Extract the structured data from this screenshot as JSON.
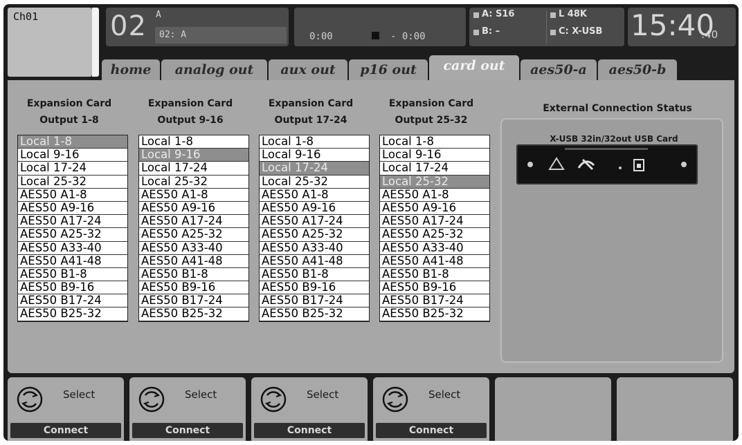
{
  "header": {
    "channel": "Ch01",
    "scene_number": "02",
    "scene_name": "A",
    "scene_sub": "02: A",
    "time_start": "0:00",
    "time_remaining": "- 0:00",
    "status": {
      "a": "A: S16",
      "b": "B:  –",
      "l": "L  48K",
      "c": "C: X-USB"
    },
    "clock": "15:40",
    "clock_sec": ":40"
  },
  "tabs": [
    "home",
    "analog out",
    "aux out",
    "p16 out",
    "card out",
    "aes50-a",
    "aes50-b"
  ],
  "active_tab": "card out",
  "columns": [
    {
      "title": "Expansion Card",
      "subtitle": "Output 1-8",
      "selected": 0
    },
    {
      "title": "Expansion Card",
      "subtitle": "Output 9-16",
      "selected": 1
    },
    {
      "title": "Expansion Card",
      "subtitle": "Output 17-24",
      "selected": 2
    },
    {
      "title": "Expansion Card",
      "subtitle": "Output 25-32",
      "selected": 3
    }
  ],
  "options": [
    "Local 1-8",
    "Local 9-16",
    "Local 17-24",
    "Local 25-32",
    "AES50 A1-8",
    "AES50 A9-16",
    "AES50 A17-24",
    "AES50 A25-32",
    "AES50 A33-40",
    "AES50 A41-48",
    "AES50 B1-8",
    "AES50 B9-16",
    "AES50 B17-24",
    "AES50 B25-32"
  ],
  "external": {
    "title": "External Connection Status",
    "card_title": "X-USB   32in/32out USB Card"
  },
  "softkeys": [
    {
      "label": "Select",
      "action": "Connect"
    },
    {
      "label": "Select",
      "action": "Connect"
    },
    {
      "label": "Select",
      "action": "Connect"
    },
    {
      "label": "Select",
      "action": "Connect"
    }
  ],
  "colors": {
    "frame": "#1d1d1d",
    "panel": "#a7a7a7",
    "selected_item": "#8e8e8e"
  }
}
